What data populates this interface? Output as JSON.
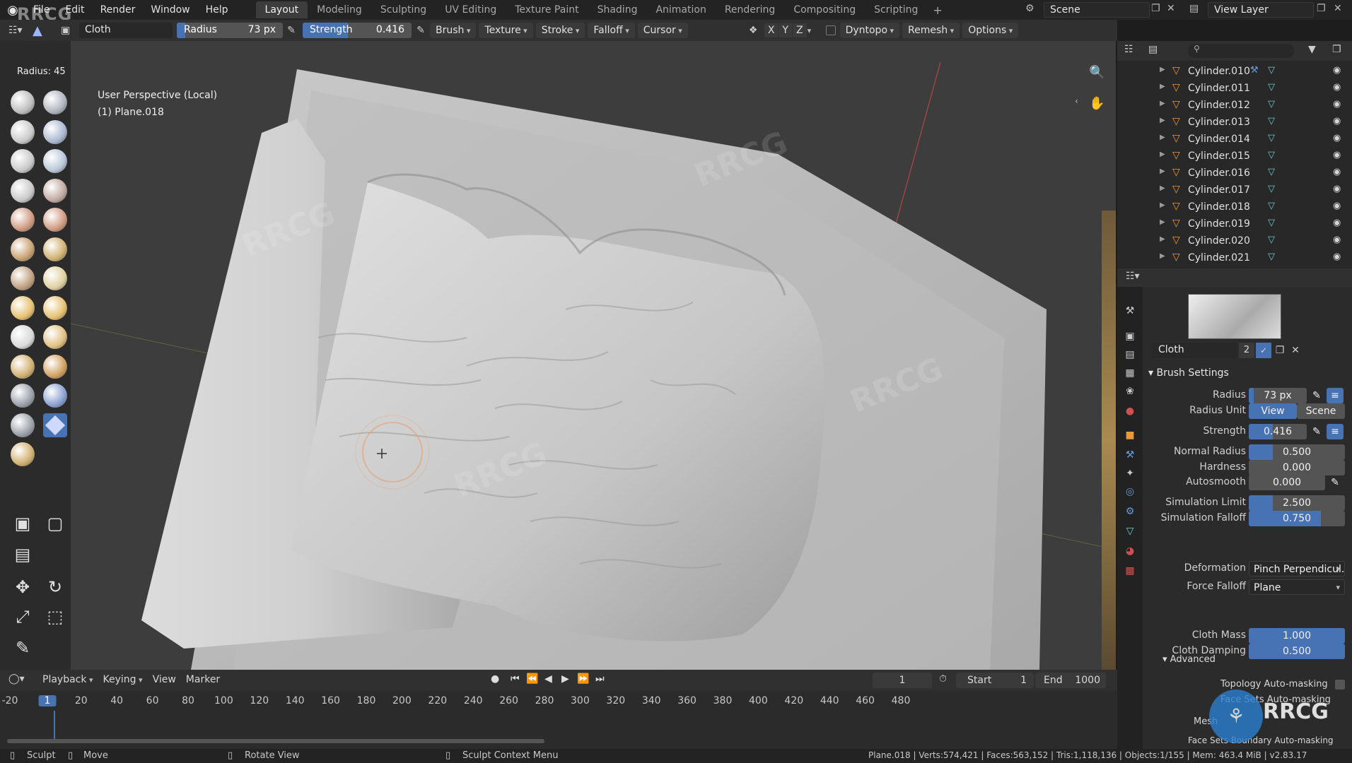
{
  "watermark_logo": "RRCG",
  "menu": [
    "File",
    "Edit",
    "Render",
    "Window",
    "Help"
  ],
  "workspaces": [
    "Layout",
    "Modeling",
    "Sculpting",
    "UV Editing",
    "Texture Paint",
    "Shading",
    "Animation",
    "Rendering",
    "Compositing",
    "Scripting"
  ],
  "active_workspace": "Layout",
  "scene": "Scene",
  "view_layer": "View Layer",
  "header": {
    "brush_name": "Cloth",
    "radius_label": "Radius",
    "radius_value": "73 px",
    "strength_label": "Strength",
    "strength_value": "0.416",
    "strength_fraction": 0.416,
    "menus": [
      "Brush",
      "Texture",
      "Stroke",
      "Falloff",
      "Cursor"
    ],
    "axes": [
      "X",
      "Y",
      "Z"
    ],
    "dyntopo": "Dyntopo",
    "remesh": "Remesh",
    "options": "Options"
  },
  "radius_readout": "Radius: 45",
  "viewport": {
    "perspective": "User Perspective (Local)",
    "object": "(1) Plane.018"
  },
  "outliner": {
    "items": [
      "Cylinder.010",
      "Cylinder.011",
      "Cylinder.012",
      "Cylinder.013",
      "Cylinder.014",
      "Cylinder.015",
      "Cylinder.016",
      "Cylinder.017",
      "Cylinder.018",
      "Cylinder.019",
      "Cylinder.020",
      "Cylinder.021"
    ]
  },
  "properties": {
    "brush_name": "Cloth",
    "brush_users": "2",
    "section": "Brush Settings",
    "rows": [
      {
        "label": "Radius",
        "value": "73 px",
        "fill": 0.08
      },
      {
        "label": "Strength",
        "value": "0.416",
        "fill": 0.416
      },
      {
        "label": "Normal Radius",
        "value": "0.500",
        "fill": 0.25
      },
      {
        "label": "Hardness",
        "value": "0.000",
        "fill": 0
      },
      {
        "label": "Autosmooth",
        "value": "0.000",
        "fill": 0
      },
      {
        "label": "Simulation Limit",
        "value": "2.500",
        "fill": 0.25
      },
      {
        "label": "Simulation Falloff",
        "value": "0.750",
        "fill": 0.75
      },
      {
        "label": "Cloth Mass",
        "value": "1.000",
        "fill": 1.0
      },
      {
        "label": "Cloth Damping",
        "value": "0.500",
        "fill": 1.0
      }
    ],
    "radius_unit_label": "Radius Unit",
    "radius_unit_options": [
      "View",
      "Scene"
    ],
    "deformation_label": "Deformation",
    "deformation_value": "Pinch Perpendicul...",
    "force_falloff_label": "Force Falloff",
    "force_falloff_value": "Plane",
    "advanced": "Advanced",
    "topology_automasking": "Topology Auto-masking",
    "face_sets_automasking": "Face Sets Auto-masking",
    "mesh_label": "Mesh",
    "face_sets_boundary": "Face Sets Boundary Auto-masking"
  },
  "timeline": {
    "menus": [
      "Playback",
      "Keying",
      "View",
      "Marker"
    ],
    "current_frame": "1",
    "start_label": "Start",
    "start": "1",
    "end_label": "End",
    "end": "1000",
    "ticks": [
      "-20",
      "1",
      "20",
      "40",
      "60",
      "80",
      "100",
      "120",
      "140",
      "160",
      "180",
      "200",
      "220",
      "240",
      "260",
      "280",
      "300",
      "320",
      "340",
      "360",
      "380",
      "400",
      "420",
      "440",
      "460",
      "480"
    ]
  },
  "status": {
    "sculpt": "Sculpt",
    "move": "Move",
    "rotate": "Rotate View",
    "context": "Sculpt Context Menu",
    "stats": "Plane.018 | Verts:574,421 | Faces:563,152 | Tris:1,118,136 | Objects:1/155 | Mem: 463.4 MiB | v2.83.17"
  },
  "colors": {
    "accent": "#4772b3",
    "panel": "#2b2b2b",
    "viewport_bg": "#3d3d3d",
    "object_orange": "#e69a3a",
    "mesh_teal": "#6fc7c9"
  }
}
